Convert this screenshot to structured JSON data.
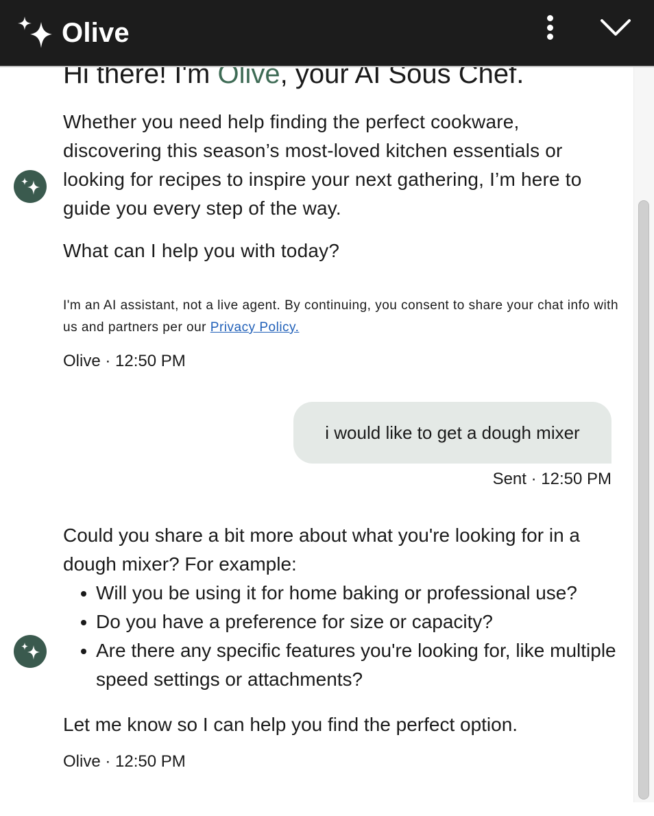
{
  "header": {
    "brand_name": "Olive",
    "logo_icon": "sparkle-icon",
    "menu_icon": "more-vertical-icon",
    "collapse_icon": "chevron-down-icon",
    "background": "#1c1c1c"
  },
  "conversation": {
    "greeting": {
      "title_before": "Hi there! I'm ",
      "title_name": "Olive",
      "title_after": ", your AI Sous Chef.",
      "paragraph": "Whether you need help finding the perfect cookware, discovering this season’s most-loved kitchen essentials or looking for recipes to inspire your next gathering, I’m here to guide you every step of the way.",
      "question": "What can I help you with today?",
      "disclaimer_text": "I'm an AI assistant, not a live agent. By continuing, you consent to share your chat info with us and partners per our ",
      "privacy_link": "Privacy Policy.",
      "meta": "Olive · 12:50 PM"
    },
    "user_message": {
      "text": "i would like to get a dough mixer",
      "meta": "Sent · 12:50 PM"
    },
    "bot_reply": {
      "intro": "Could you share a bit more about what you're looking for in a dough mixer? For example:",
      "bullets": [
        "Will you be using it for home baking or professional use?",
        "Do you have a preference for size or capacity?",
        "Are there any specific features you're looking for, like multiple speed settings or attachments?"
      ],
      "outro": "Let me know so I can help you find the perfect option.",
      "meta": "Olive · 12:50 PM"
    }
  },
  "colors": {
    "accent_olive": "#3e6b55",
    "avatar": "#3a5a4e",
    "user_bubble": "#e4e9e6",
    "link": "#1f5fb8"
  }
}
